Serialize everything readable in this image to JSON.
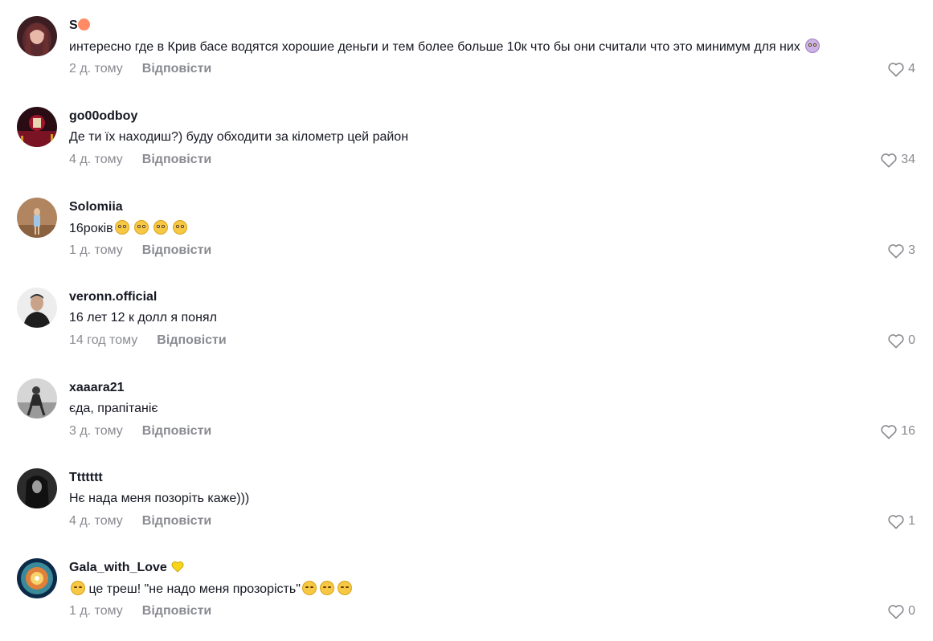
{
  "reply_label": "Відповісти",
  "colors": {
    "muted": "#8a8b91",
    "text": "#161823"
  },
  "comments": [
    {
      "username": "S",
      "username_emoji": "person-emoji",
      "text": "интересно где в Крив басе водятся хорошие деньги и тем более больше 10к что бы они считали что это минимум для них",
      "text_emoji": "person-shrugging-emoji",
      "time": "2 д. тому",
      "likes": "4"
    },
    {
      "username": "go00odboy",
      "text": "Де ти їх находиш?) буду обходити за кілометр цей район",
      "time": "4 д. тому",
      "likes": "34"
    },
    {
      "username": "Solomiia",
      "text": "16років",
      "text_emoji": "flushed-face-emoji x4",
      "time": "1 д. тому",
      "likes": "3"
    },
    {
      "username": "veronn.official",
      "text": "16 лет 12 к долл я понял",
      "time": "14 год тому",
      "likes": "0"
    },
    {
      "username": "xaaara21",
      "text": "єда, прапітаніє",
      "time": "3 д. тому",
      "likes": "16"
    },
    {
      "username": "Ttttttt",
      "text": "Нє нада меня позоріть каже)))",
      "time": "4 д. тому",
      "likes": "1"
    },
    {
      "username": "Gala_with_Love",
      "username_emoji": "yellow-heart-emoji",
      "text": " це треш! \"не надо меня прозорість\"",
      "text_emoji": "rolling-laughing-emoji, grinning-sweat-emoji",
      "time": "1 д. тому",
      "likes": "0"
    }
  ]
}
